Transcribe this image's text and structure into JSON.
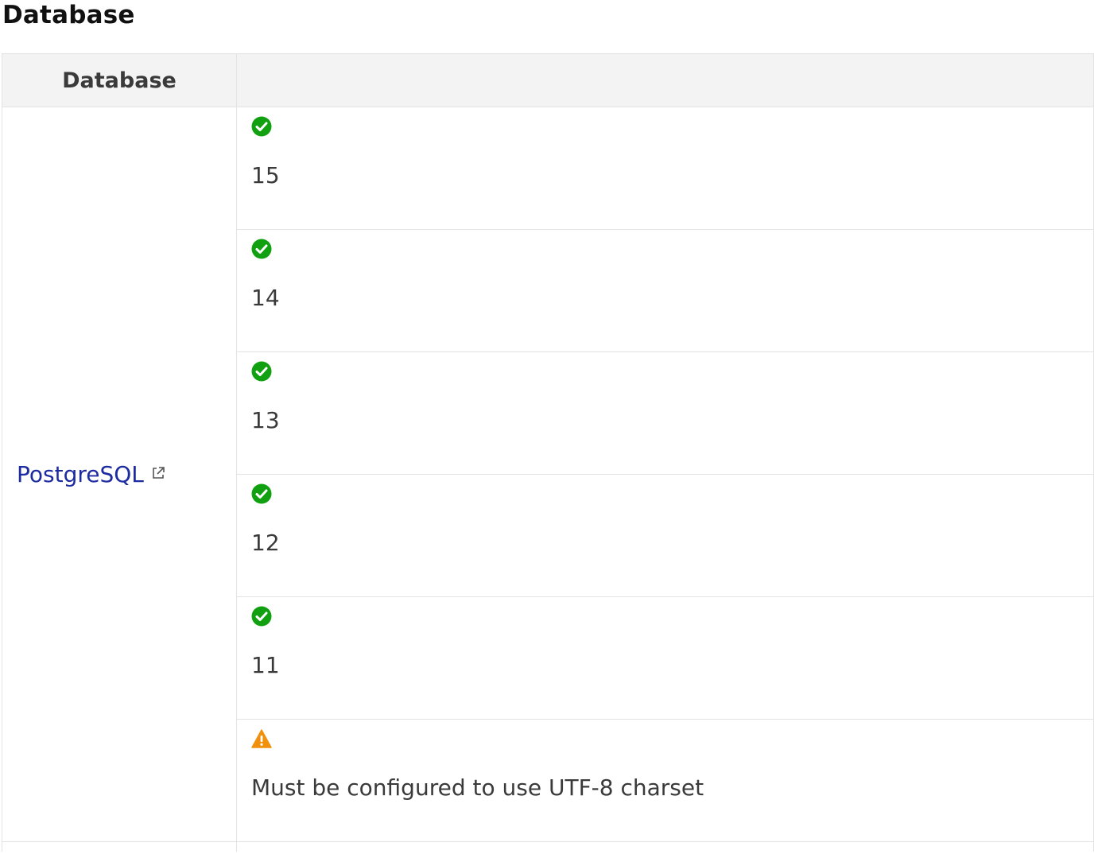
{
  "section": {
    "title": "Database"
  },
  "table": {
    "headers": [
      "Database",
      ""
    ],
    "database": {
      "name": "PostgreSQL",
      "icon": "external-link-icon"
    },
    "rows": [
      {
        "status": "check-circle-icon",
        "status_color": "#10a010",
        "text": "15"
      },
      {
        "status": "check-circle-icon",
        "status_color": "#10a010",
        "text": "14"
      },
      {
        "status": "check-circle-icon",
        "status_color": "#10a010",
        "text": "13"
      },
      {
        "status": "check-circle-icon",
        "status_color": "#10a010",
        "text": "12"
      },
      {
        "status": "check-circle-icon",
        "status_color": "#10a010",
        "text": "11"
      },
      {
        "status": "warning-icon",
        "status_color": "#f0900c",
        "text": "Must be configured to use UTF-8 charset"
      }
    ]
  },
  "colors": {
    "link": "#1c2ba0",
    "header_bg": "#f3f3f3",
    "border": "#e3e3e3",
    "success": "#10a010",
    "warning": "#f0900c"
  }
}
